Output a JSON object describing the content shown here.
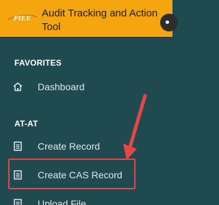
{
  "header": {
    "logo_text": "PIEE",
    "app_title": "Audit Tracking and Action Tool",
    "accent_color": "#f5a50e"
  },
  "sidebar": {
    "background": "#1f4a50",
    "sections": [
      {
        "title": "FAVORITES",
        "items": [
          {
            "label": "Dashboard",
            "icon": "home-icon"
          }
        ]
      },
      {
        "title": "AT-AT",
        "items": [
          {
            "label": "Create Record",
            "icon": "document-icon"
          },
          {
            "label": "Create CAS Record",
            "icon": "document-icon"
          },
          {
            "label": "Upload File",
            "icon": "document-icon"
          }
        ]
      }
    ]
  },
  "annotation": {
    "arrow_color": "#e84545",
    "highlighted_item": "Create CAS Record"
  }
}
